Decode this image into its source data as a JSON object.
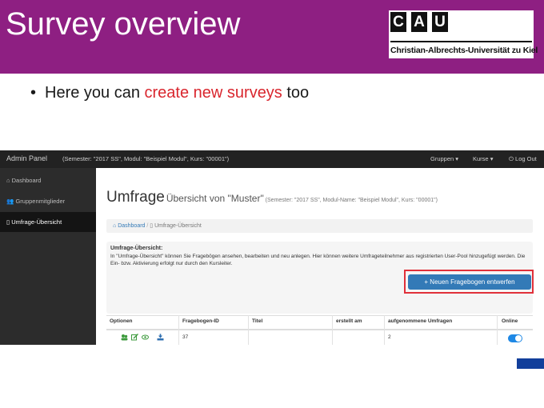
{
  "slide": {
    "title": "Survey overview",
    "bullet_before": "Here you can ",
    "bullet_highlight": "create new surveys",
    "bullet_after": " too",
    "highlight_color": "#d9262e",
    "banner_color": "#8e1f82"
  },
  "logo": {
    "letters": [
      "C",
      "A",
      "U"
    ],
    "name": "Christian-Albrechts-Universität zu Kiel"
  },
  "app": {
    "topbar": {
      "brand": "Admin Panel",
      "context": "(Semester: \"2017 SS\", Modul: \"Beispiel Modul\", Kurs: \"00001\")",
      "menu_groups": "Gruppen",
      "menu_courses": "Kurse",
      "logout": "Log Out"
    },
    "sidebar": {
      "items": [
        {
          "label": "Dashboard",
          "icon": "home-icon"
        },
        {
          "label": "Gruppenmitglieder",
          "icon": "users-icon"
        },
        {
          "label": "Umfrage-Übersicht",
          "icon": "document-icon"
        }
      ]
    },
    "heading": {
      "main": "Umfrage",
      "sub": "Übersicht von \"Muster\"",
      "detail": "(Semester: \"2017 SS\", Modul-Name: \"Beispiel Modul\", Kurs: \"00001\")"
    },
    "breadcrumb": {
      "home": "Dashboard",
      "current": "Umfrage-Übersicht"
    },
    "info": {
      "title": "Umfrage-Übersicht:",
      "text": "In \"Umfrage-Übersicht\" können Sie Fragebögen ansehen, bearbeiten und neu anlegen. Hier können weitere Umfrageteilnehmer aus registrierten User-Pool hinzugefügt werden. Die Ein- bzw. Aktivierung erfolgt nur durch den Kursleiter."
    },
    "new_button": "+ Neuen Fragebogen entwerfen",
    "table": {
      "columns": [
        "Optionen",
        "Fragebogen-ID",
        "Titel",
        "erstellt am",
        "aufgenommene Umfragen",
        "Online"
      ],
      "rows": [
        {
          "id": "37",
          "title": "",
          "created": "",
          "count": "2",
          "online": true
        }
      ]
    }
  }
}
